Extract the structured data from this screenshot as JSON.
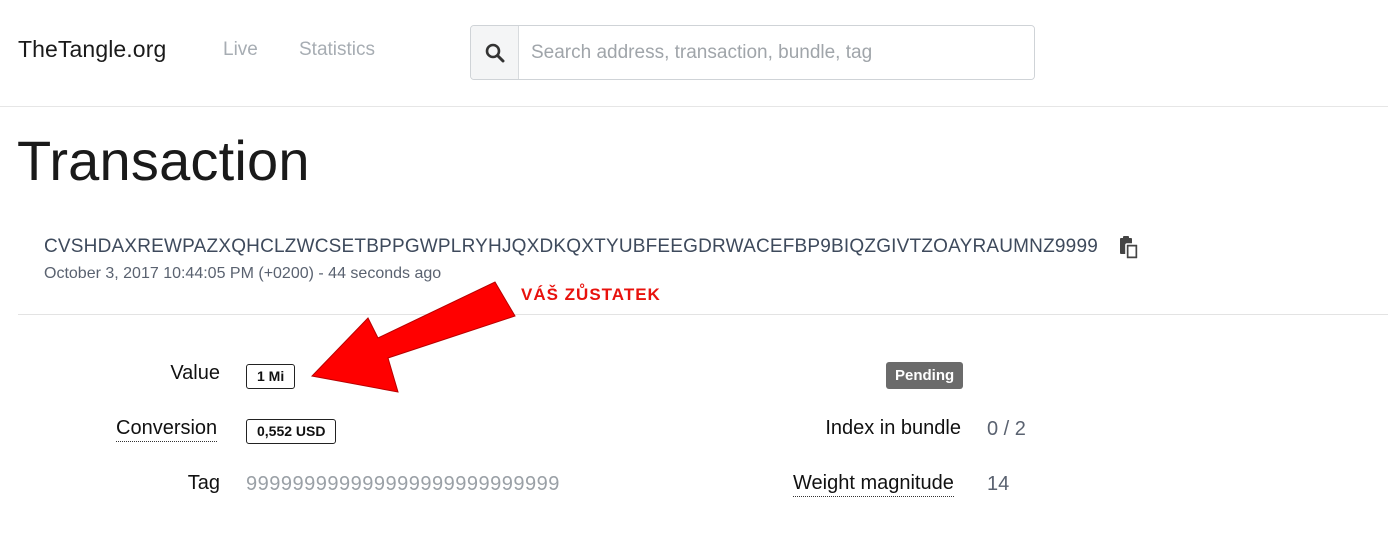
{
  "nav": {
    "brand": "TheTangle.org",
    "links": [
      "Live",
      "Statistics"
    ],
    "search_placeholder": "Search address, transaction, bundle, tag"
  },
  "page": {
    "title": "Transaction",
    "hash": "CVSHDAXREWPAZXQHCLZWCSETBPPGWPLRYHJQXDKQXTYUBFEEGDRWACEFBP9BIQZGIVTZOAYRAUMNZ9999",
    "timestamp": "October 3, 2017 10:44:05 PM (+0200) - 44 seconds ago"
  },
  "annotation": {
    "text": "VÁŠ ZŮSTATEK",
    "color": "#e8120d"
  },
  "details": {
    "value_label": "Value",
    "value": "1 Mi",
    "conversion_label": "Conversion",
    "conversion": "0,552 USD",
    "tag_label": "Tag",
    "tag": "999999999999999999999999999",
    "status": "Pending",
    "index_label": "Index in bundle",
    "index": "0 / 2",
    "weight_label": "Weight magnitude",
    "weight": "14"
  }
}
